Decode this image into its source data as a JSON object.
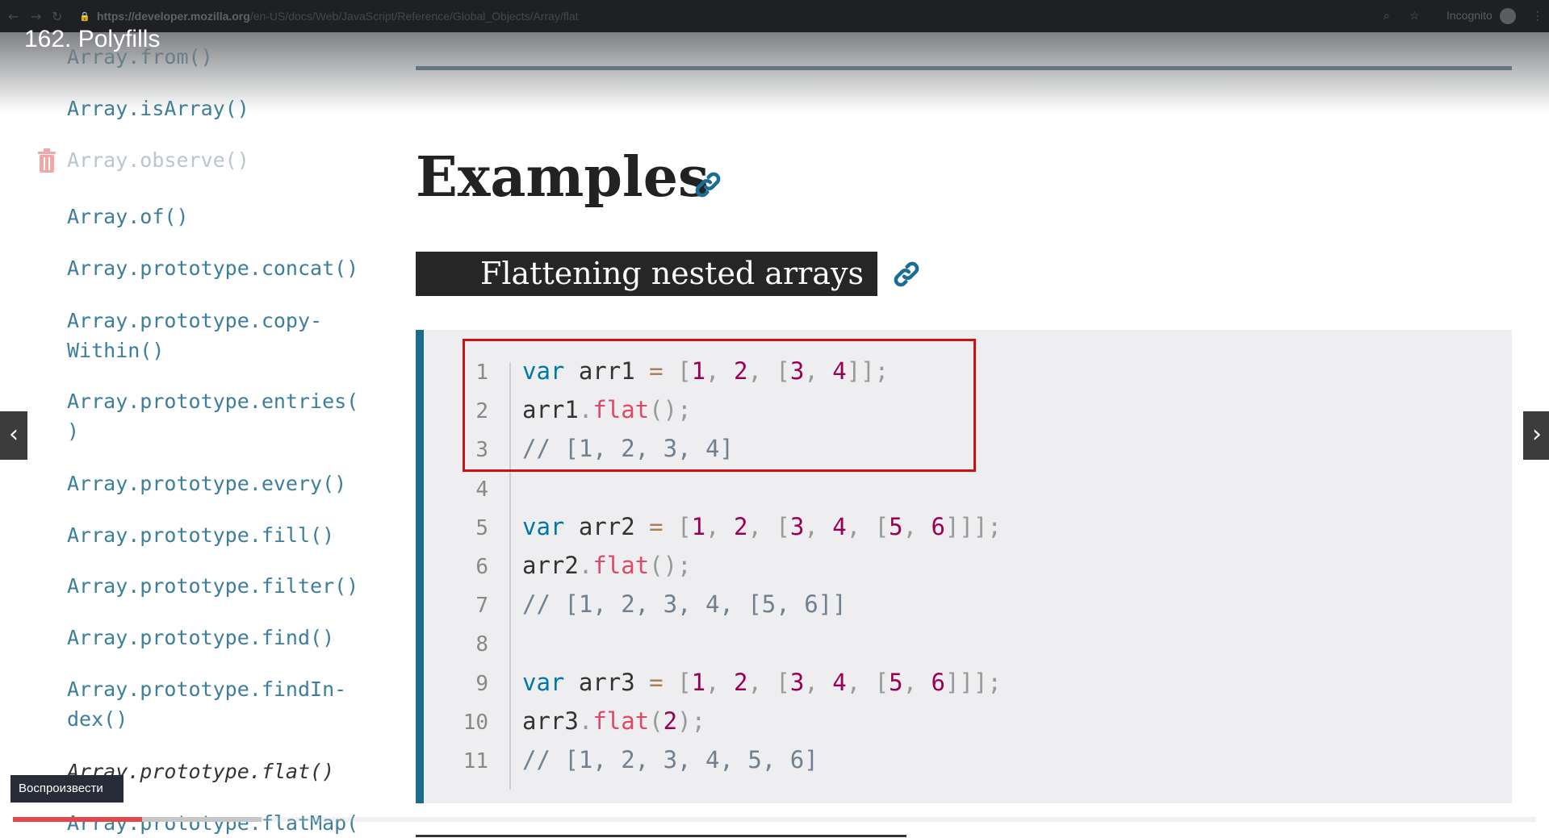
{
  "browser": {
    "url_host": "https://developer.mozilla.org",
    "url_path": "/en-US/docs/Web/JavaScript/Reference/Global_Objects/Array/flat",
    "profile_label": "Incognito"
  },
  "video": {
    "title": "162. Polyfills",
    "tooltip": "Воспроизвести",
    "progress_played_percent": 8.5,
    "progress_buffered_percent": 16.3
  },
  "sidebar": {
    "items": [
      {
        "label": "Array.from()"
      },
      {
        "label": "Array.isArray()"
      },
      {
        "label": "Array.observe()",
        "deprecated": true
      },
      {
        "label": "Array.of()"
      },
      {
        "label": "Array.prototype.concat()"
      },
      {
        "label": "Array.prototype.copy-",
        "label2": "Within()"
      },
      {
        "label": "Array.prototype.entries(",
        "label2": ")"
      },
      {
        "label": "Array.prototype.every()"
      },
      {
        "label": "Array.prototype.fill()"
      },
      {
        "label": "Array.prototype.filter()"
      },
      {
        "label": "Array.prototype.find()"
      },
      {
        "label": "Array.prototype.findIn-",
        "label2": "dex()"
      },
      {
        "label": "Array.prototype.flat()",
        "current": true
      },
      {
        "label": "Array.prototype.flatMap("
      }
    ]
  },
  "main": {
    "heading": "Examples",
    "subheading": "Flattening nested arrays",
    "code_lines": [
      "var arr1 = [1, 2, [3, 4]];",
      "arr1.flat();",
      "// [1, 2, 3, 4]",
      "",
      "var arr2 = [1, 2, [3, 4, [5, 6]]];",
      "arr2.flat();",
      "// [1, 2, 3, 4, [5, 6]]",
      "",
      "var arr3 = [1, 2, [3, 4, [5, 6]]];",
      "arr3.flat(2);",
      "// [1, 2, 3, 4, 5, 6]"
    ]
  },
  "colors": {
    "keyword": "#0077aa",
    "number": "#990055",
    "function": "#dd4a68",
    "comment": "#708090",
    "highlight_box": "#cc1111",
    "progress": "#e4474b"
  }
}
